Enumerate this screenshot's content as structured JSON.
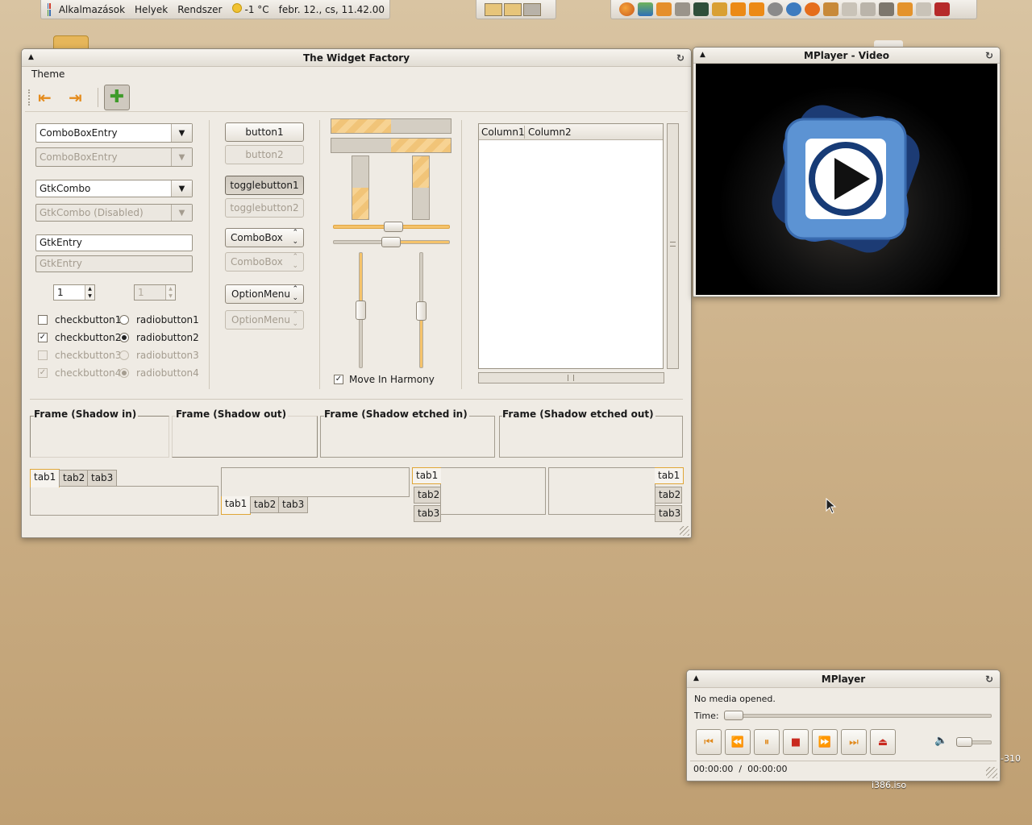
{
  "top_panel": {
    "menu_applications": "Alkalmazások",
    "menu_places": "Helyek",
    "menu_system": "Rendszer",
    "weather": "-1 °C",
    "clock": "febr. 12., cs, 11.42.00"
  },
  "desktop": {
    "label_310": "-310",
    "label_iso": "i386.iso"
  },
  "widget_factory": {
    "title": "The Widget Factory",
    "menu_theme": "Theme",
    "combo_entry_1": "ComboBoxEntry",
    "combo_entry_2": "ComboBoxEntry",
    "gtk_combo_1": "GtkCombo",
    "gtk_combo_2": "GtkCombo (Disabled)",
    "entry_1": "GtkEntry",
    "entry_2": "GtkEntry",
    "spin_1": "1",
    "spin_2": "1",
    "checkbutton1": "checkbutton1",
    "checkbutton2": "checkbutton2",
    "checkbutton3": "checkbutton3",
    "checkbutton4": "checkbutton4",
    "radiobutton1": "radiobutton1",
    "radiobutton2": "radiobutton2",
    "radiobutton3": "radiobutton3",
    "radiobutton4": "radiobutton4",
    "button1": "button1",
    "button2": "button2",
    "togglebutton1": "togglebutton1",
    "togglebutton2": "togglebutton2",
    "combobox_1": "ComboBox",
    "combobox_2": "ComboBox",
    "optionmenu_1": "OptionMenu",
    "optionmenu_2": "OptionMenu",
    "move_in_harmony": "Move In Harmony",
    "column1": "Column1",
    "column2": "Column2",
    "frame_shadow_in": "Frame (Shadow in)",
    "frame_shadow_out": "Frame (Shadow out)",
    "frame_shadow_etched_in": "Frame (Shadow etched in)",
    "frame_shadow_etched_out": "Frame (Shadow etched out)",
    "tab1": "tab1",
    "tab2": "tab2",
    "tab3": "tab3",
    "progress_1": 0.5,
    "progress_2": 0.5,
    "accent": "#f5c36b"
  },
  "mplayer_video": {
    "title": "MPlayer - Video"
  },
  "mplayer": {
    "title": "MPlayer",
    "status": "No media opened.",
    "time_label": "Time:",
    "time_display": "00:00:00  /  00:00:00"
  }
}
